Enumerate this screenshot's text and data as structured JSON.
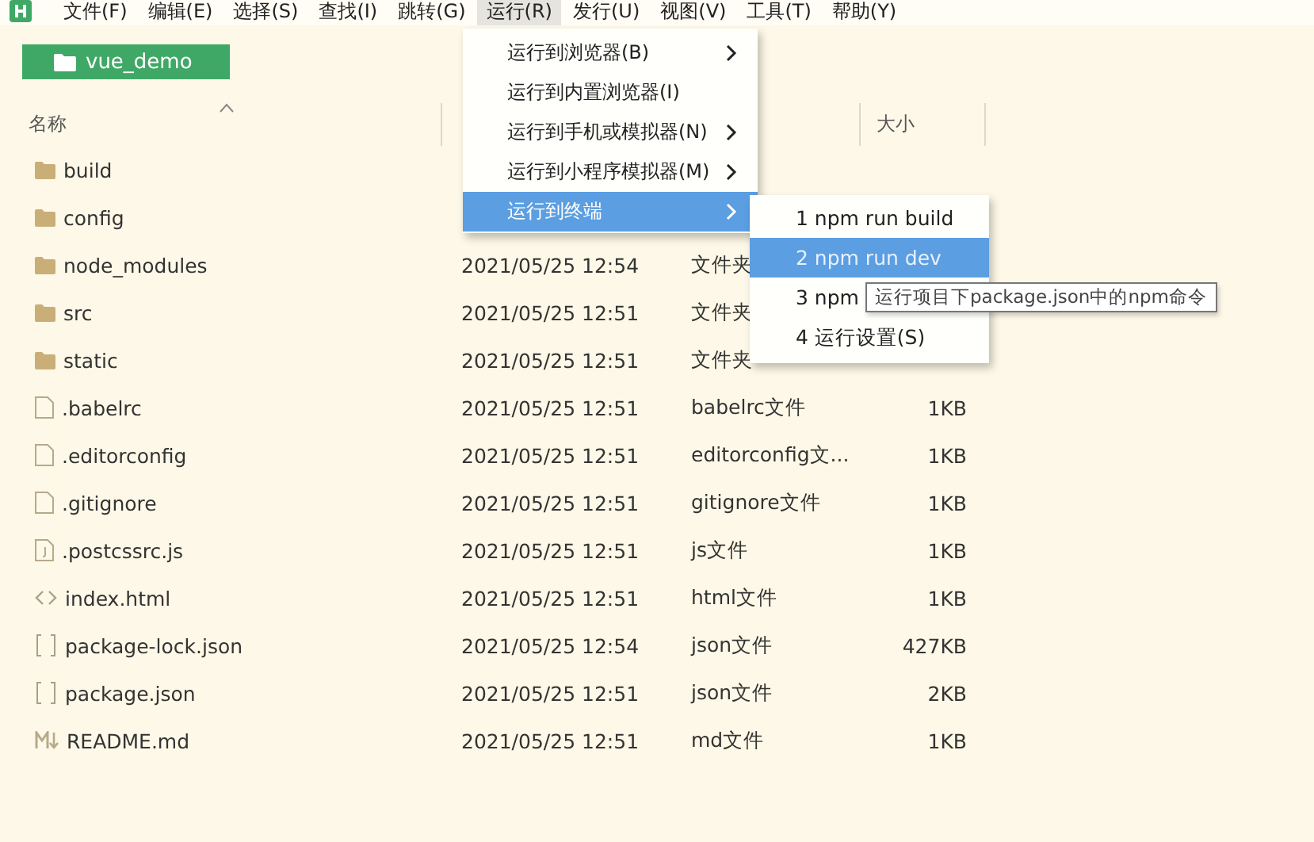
{
  "menubar": [
    {
      "label": "文件(F)",
      "selected": false
    },
    {
      "label": "编辑(E)",
      "selected": false
    },
    {
      "label": "选择(S)",
      "selected": false
    },
    {
      "label": "查找(I)",
      "selected": false
    },
    {
      "label": "跳转(G)",
      "selected": false
    },
    {
      "label": "运行(R)",
      "selected": true
    },
    {
      "label": "发行(U)",
      "selected": false
    },
    {
      "label": "视图(V)",
      "selected": false
    },
    {
      "label": "工具(T)",
      "selected": false
    },
    {
      "label": "帮助(Y)",
      "selected": false
    }
  ],
  "project_button": {
    "label": "vue_demo"
  },
  "table": {
    "columns": [
      {
        "label": "名称",
        "sorted": true
      },
      {
        "label": "大小",
        "sorted": false
      }
    ],
    "rows": [
      {
        "kind": "folder",
        "name": "build"
      },
      {
        "kind": "folder",
        "name": "config"
      },
      {
        "kind": "folder",
        "name": "node_modules",
        "date": "2021/05/25 12:54",
        "type": "文件夹"
      },
      {
        "kind": "folder",
        "name": "src",
        "date": "2021/05/25 12:51",
        "type": "文件夹"
      },
      {
        "kind": "folder",
        "name": "static",
        "date": "2021/05/25 12:51",
        "type": "文件夹"
      },
      {
        "kind": "file",
        "name": ".babelrc",
        "date": "2021/05/25 12:51",
        "type": "babelrc文件",
        "size": "1KB"
      },
      {
        "kind": "file",
        "name": ".editorconfig",
        "date": "2021/05/25 12:51",
        "type": "editorconfig文...",
        "size": "1KB"
      },
      {
        "kind": "file",
        "name": ".gitignore",
        "date": "2021/05/25 12:51",
        "type": "gitignore文件",
        "size": "1KB"
      },
      {
        "kind": "js",
        "name": ".postcssrc.js",
        "date": "2021/05/25 12:51",
        "type": "js文件",
        "size": "1KB"
      },
      {
        "kind": "html",
        "name": "index.html",
        "date": "2021/05/25 12:51",
        "type": "html文件",
        "size": "1KB"
      },
      {
        "kind": "json",
        "name": "package-lock.json",
        "date": "2021/05/25 12:54",
        "type": "json文件",
        "size": "427KB"
      },
      {
        "kind": "json",
        "name": "package.json",
        "date": "2021/05/25 12:51",
        "type": "json文件",
        "size": "2KB"
      },
      {
        "kind": "md",
        "name": "README.md",
        "date": "2021/05/25 12:51",
        "type": "md文件",
        "size": "1KB"
      }
    ]
  },
  "run_menu": [
    {
      "label": "运行到浏览器(B)",
      "has_submenu": true,
      "selected": false
    },
    {
      "label": "运行到内置浏览器(I)",
      "has_submenu": false,
      "selected": false
    },
    {
      "label": "运行到手机或模拟器(N)",
      "has_submenu": true,
      "selected": false
    },
    {
      "label": "运行到小程序模拟器(M)",
      "has_submenu": true,
      "selected": false
    },
    {
      "label": "运行到终端",
      "has_submenu": true,
      "selected": true
    }
  ],
  "terminal_submenu": [
    {
      "label": "1 npm run build",
      "selected": false
    },
    {
      "label": "2 npm run dev",
      "selected": true
    },
    {
      "label": "3 npm",
      "selected": false
    },
    {
      "label": "4 运行设置(S)",
      "selected": false
    }
  ],
  "tooltip": "运行项目下package.json中的npm命令"
}
